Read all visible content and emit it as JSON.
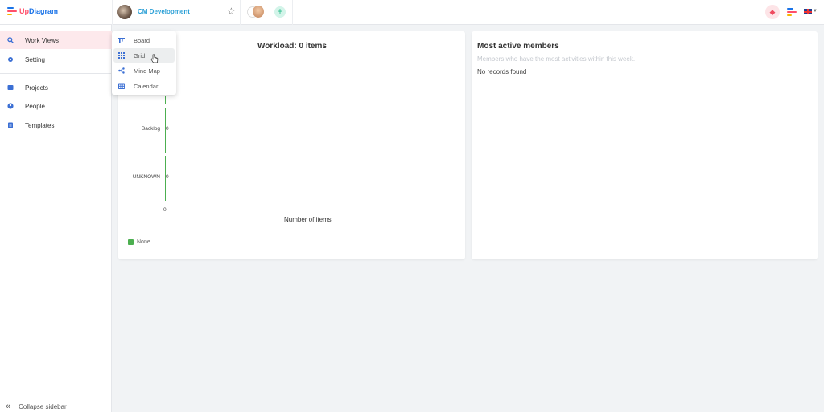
{
  "app": {
    "logo_prefix": "Up",
    "logo_suffix": "Diagram",
    "project_name": "CM Development"
  },
  "sidebar": {
    "items": [
      {
        "label": "Work Views",
        "icon": "search-icon",
        "active": true
      },
      {
        "label": "Setting",
        "icon": "gear-icon",
        "active": false
      },
      {
        "label": "Projects",
        "icon": "book-icon",
        "active": false
      },
      {
        "label": "People",
        "icon": "person-icon",
        "active": false
      },
      {
        "label": "Templates",
        "icon": "clipboard-icon",
        "active": false
      }
    ],
    "collapse_label": "Collapse sidebar"
  },
  "dropdown": {
    "items": [
      {
        "label": "Board",
        "icon": "board-icon"
      },
      {
        "label": "Grid",
        "icon": "grid-icon"
      },
      {
        "label": "Mind Map",
        "icon": "mind-map-icon"
      },
      {
        "label": "Calendar",
        "icon": "calendar-icon"
      }
    ]
  },
  "workload": {
    "title": "Workload: 0 items",
    "legend": "None"
  },
  "active_members": {
    "title": "Most active members",
    "subtitle": "Members who have the most activities within this week.",
    "empty": "No records found"
  },
  "chart_data": {
    "type": "bar",
    "orientation": "horizontal",
    "title": "Workload: 0 items",
    "categories": [
      "Backlog",
      "UNKNOWN"
    ],
    "series": [
      {
        "name": "None",
        "values": [
          0,
          0
        ]
      }
    ],
    "value_labels": [
      "0",
      "0"
    ],
    "xlabel": "Number of items",
    "ylabel": "",
    "x_tick": "0",
    "xlim": [
      0,
      0
    ],
    "legend": "bottom-left",
    "series_color": "#4caf50"
  },
  "colors": {
    "accent": "#2a9fd6",
    "active_bg": "#fde9ec",
    "brand_blue": "#1a73e8",
    "brand_red": "#ff4f6a"
  }
}
